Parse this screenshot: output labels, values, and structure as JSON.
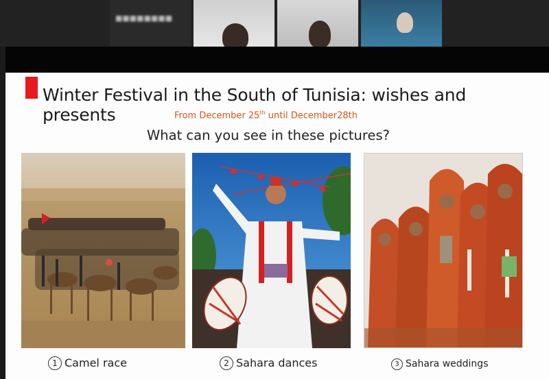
{
  "meeting": {
    "participants": [
      {
        "name": "■■■■■■■■"
      },
      {
        "name": ""
      },
      {
        "name": ""
      },
      {
        "name": ""
      }
    ]
  },
  "slide": {
    "title": "Winter Festival in the South of Tunisia: wishes and presents",
    "subtitle_pre": "From December 25",
    "subtitle_sup": "th",
    "subtitle_post": " until December28th",
    "question": "What can you see in these pictures?",
    "captions": [
      {
        "num": "1",
        "text": "Camel race"
      },
      {
        "num": "2",
        "text": "Sahara dances"
      },
      {
        "num": "3",
        "text": "Sahara weddings"
      }
    ],
    "accent_color": "#e8191f",
    "subtitle_color": "#d9541c"
  }
}
